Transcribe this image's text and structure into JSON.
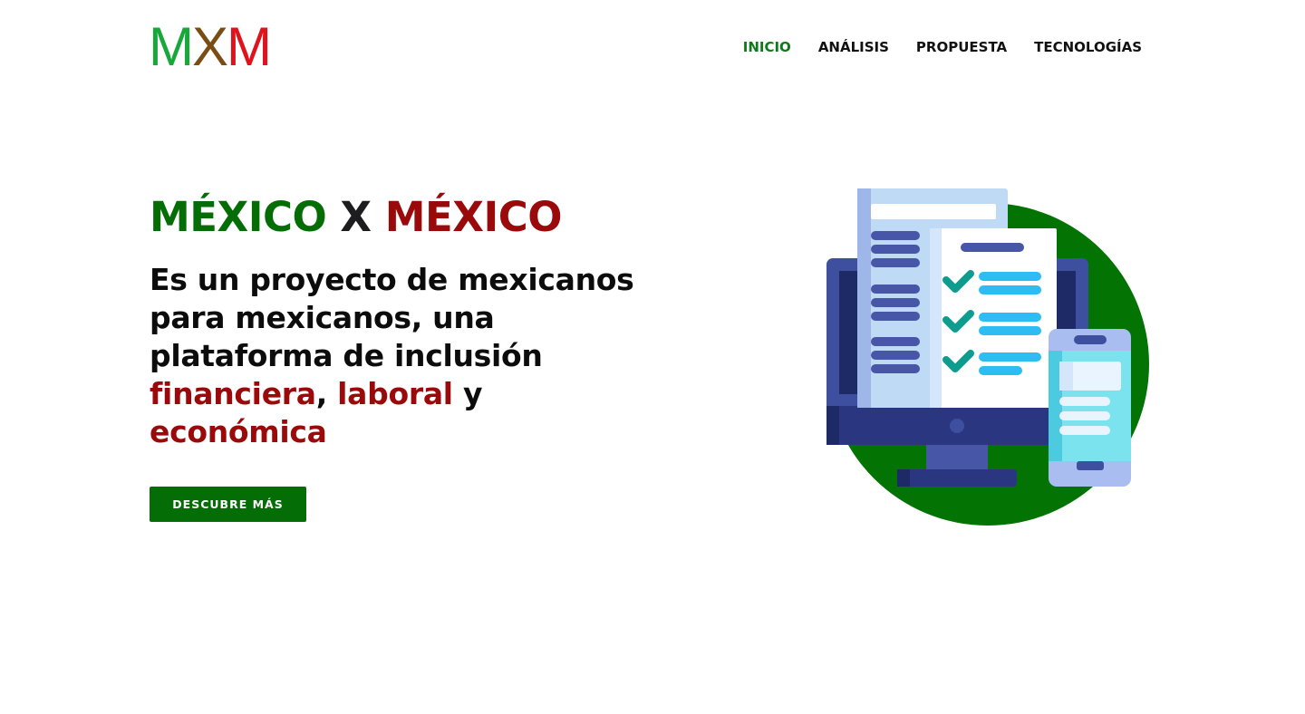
{
  "header": {
    "logo": {
      "letters": [
        "M",
        "X",
        "M"
      ],
      "colors": [
        "#17a83a",
        "#7a4d14",
        "#e0121b"
      ]
    },
    "nav": [
      {
        "label": "INICIO",
        "active": true
      },
      {
        "label": "ANÁLISIS",
        "active": false
      },
      {
        "label": "PROPUESTA",
        "active": false
      },
      {
        "label": "TECNOLOGÍAS",
        "active": false
      }
    ]
  },
  "hero": {
    "title": {
      "part1": "MÉXICO",
      "part2": " X ",
      "part3": "MÉXICO"
    },
    "text": {
      "intro": "Es un proyecto de mexicanos para mexicanos, una plataforma de inclusión ",
      "hl1": "financiera",
      "sep1": ", ",
      "hl2": "laboral",
      "sep2": " y ",
      "hl3": "económica"
    },
    "cta_label": "DESCUBRE MÁS"
  },
  "colors": {
    "green": "#056d06",
    "red": "#9b0a0a",
    "dark": "#1d1d1f",
    "nav_active": "#0f7a1a",
    "illustration_circle": "#037304"
  },
  "icons": [
    "computer-checklist-illustration",
    "smartphone-icon",
    "checkmark-icon"
  ]
}
